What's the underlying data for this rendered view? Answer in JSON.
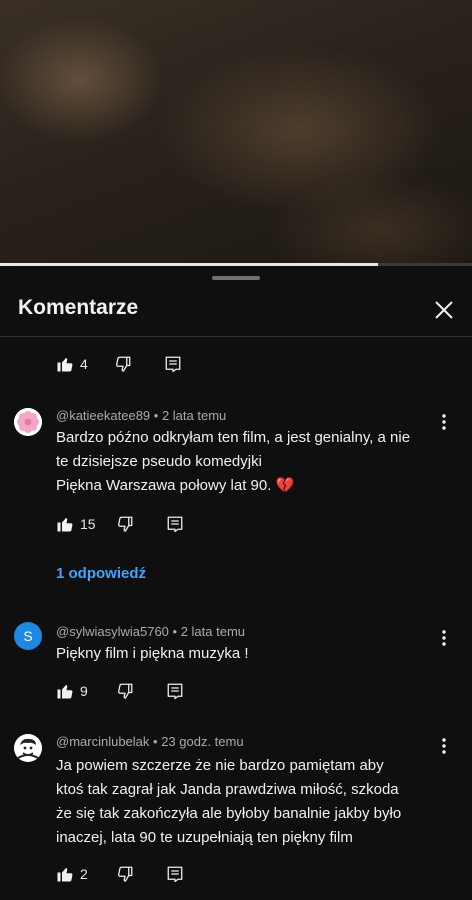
{
  "video": {
    "progress": 0.8
  },
  "panel": {
    "title": "Komentarze"
  },
  "top_actions": {
    "likes": "4"
  },
  "comments": [
    {
      "author": "@katieekatee89",
      "time": "2 lata temu",
      "lines": [
        "Bardzo późno odkryłam ten film, a jest genialny, a nie",
        "te dzisiejsze pseudo komedyjki",
        "Piękna Warszawa połowy lat 90. 💔"
      ],
      "likes": "15",
      "replies_label": "1 odpowiedź",
      "avatar_color": "#f4c3d6"
    },
    {
      "author": "@sylwiasylwia5760",
      "time": "2 lata temu",
      "lines": [
        "Piękny film i piękna muzyka !"
      ],
      "likes": "9",
      "avatar_letter": "S",
      "avatar_color": "#1e88e5"
    },
    {
      "author": "@marcinlubelak",
      "time": "23 godz. temu",
      "lines": [
        "Ja powiem szczerze że nie bardzo pamiętam aby",
        "ktoś tak zagrał jak Janda prawdziwa miłość, szkoda",
        "że się tak zakończyła ale byłoby banalnie jakby było",
        "inaczej, lata 90 te uzupełniają ten piękny film"
      ],
      "likes": "2"
    }
  ]
}
